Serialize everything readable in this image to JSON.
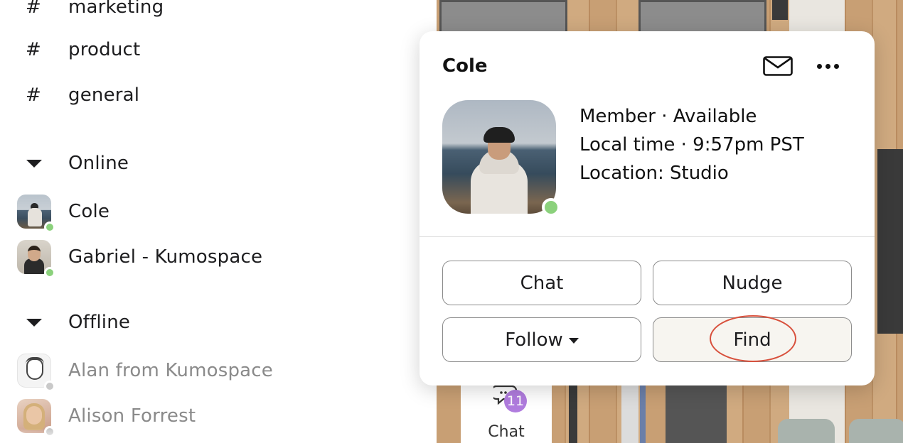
{
  "sidebar": {
    "channels": [
      {
        "label": "marketing",
        "icon": "hash-icon"
      },
      {
        "label": "product",
        "icon": "hash-icon"
      },
      {
        "label": "general",
        "icon": "hash-icon"
      }
    ],
    "online_section": {
      "label": "Online"
    },
    "online_members": [
      {
        "name": "Cole",
        "status": "online"
      },
      {
        "name": "Gabriel - Kumospace",
        "status": "online"
      }
    ],
    "offline_section": {
      "label": "Offline"
    },
    "offline_members": [
      {
        "name": "Alan from Kumospace",
        "status": "offline"
      },
      {
        "name": "Alison Forrest",
        "status": "offline"
      }
    ]
  },
  "dock": {
    "chat_label": "Chat",
    "unread_badge": "11"
  },
  "profile_card": {
    "name": "Cole",
    "role_status": "Member · Available",
    "local_time": "Local time · 9:57pm PST",
    "location": "Location: Studio",
    "buttons": {
      "chat": "Chat",
      "nudge": "Nudge",
      "follow": "Follow",
      "find": "Find"
    }
  },
  "colors": {
    "online": "#8bd17c",
    "offline": "#c9c9c9",
    "badge": "#b07cde",
    "highlight_ring": "#d8503c"
  }
}
